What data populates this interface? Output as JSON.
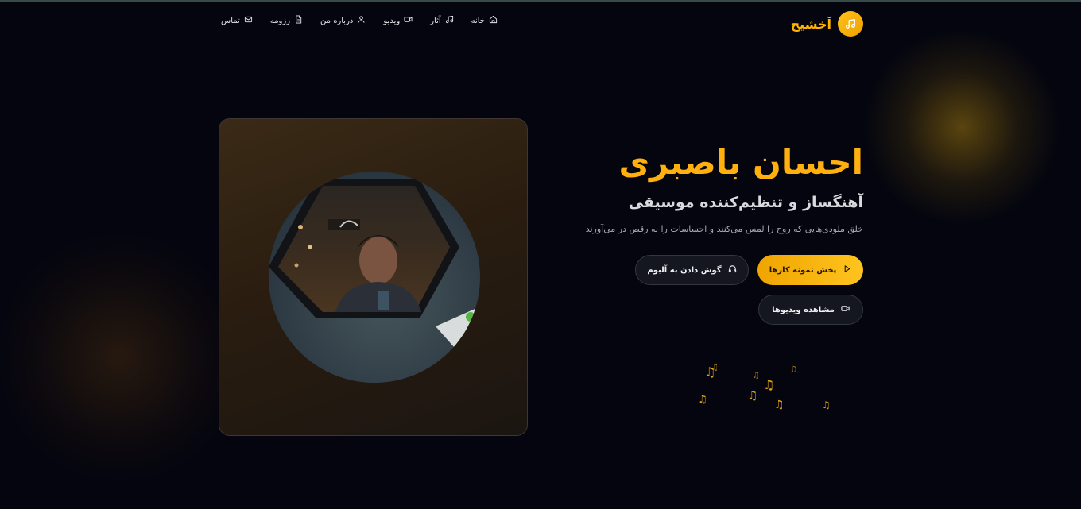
{
  "header": {
    "brand_name": "آخشیج",
    "brand_icon": "music-note-icon",
    "nav": [
      {
        "label": "خانه",
        "icon": "home-icon"
      },
      {
        "label": "آثار",
        "icon": "music-note-icon"
      },
      {
        "label": "ویدیو",
        "icon": "video-icon"
      },
      {
        "label": "درباره من",
        "icon": "user-icon"
      },
      {
        "label": "رزومه",
        "icon": "document-icon"
      },
      {
        "label": "تماس",
        "icon": "mail-icon"
      }
    ]
  },
  "hero": {
    "title": "احسان باصبری",
    "subtitle": "آهنگساز و تنظیم‌کننده موسیقی",
    "description": "خلق ملودی‌هایی که روح را لمس می‌کنند و احساسات را به رقص در می‌آورند",
    "buttons": {
      "play_samples": "پخش نمونه کارها",
      "listen_album": "گوش دادن به آلبوم",
      "watch_videos": "مشاهده ویدیوها"
    }
  },
  "colors": {
    "accent": "#ffb400",
    "background": "#04050f"
  }
}
